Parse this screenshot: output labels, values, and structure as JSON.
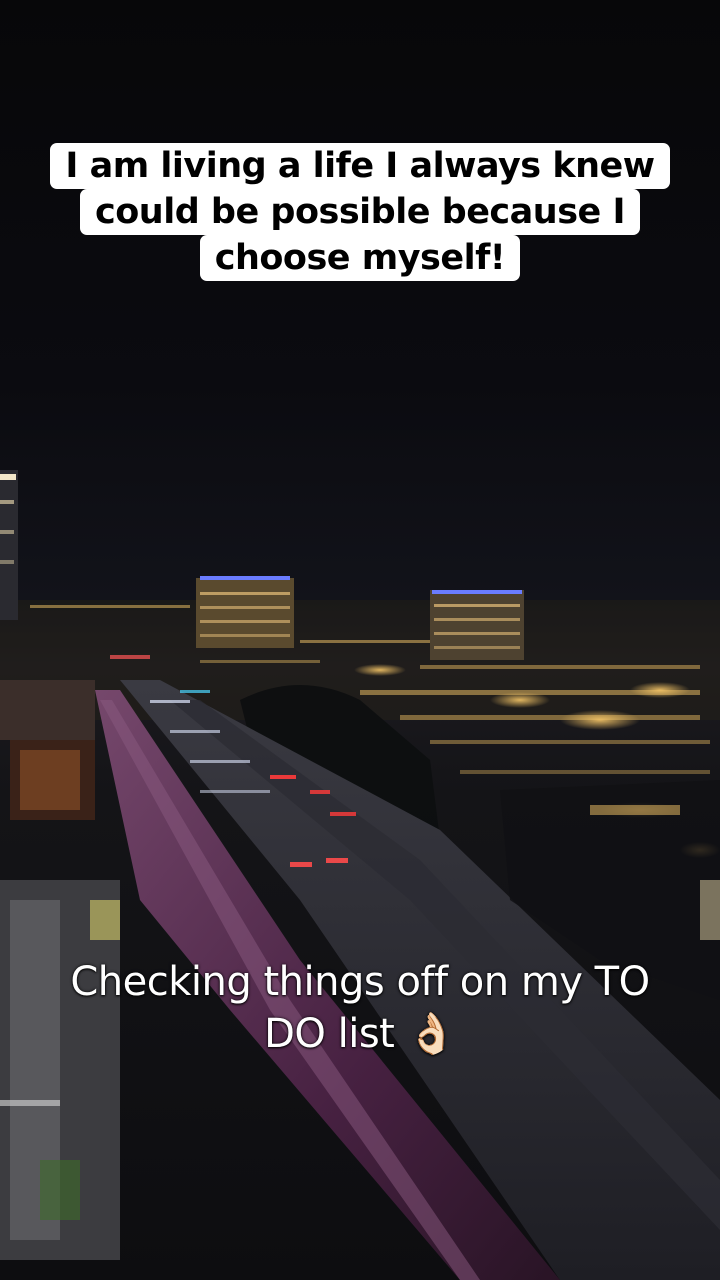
{
  "overlay_top": {
    "lines": [
      "I am living a life I always knew",
      "could be possible because I",
      "choose myself!"
    ]
  },
  "overlay_bottom": {
    "lines": [
      "Checking things off on my TO",
      "DO list 👌🏻"
    ]
  },
  "colors": {
    "sky": "#0b0b10",
    "city_light": "#f6c667",
    "tail_light": "#ff3b3b",
    "railing": "#5a2a55"
  }
}
